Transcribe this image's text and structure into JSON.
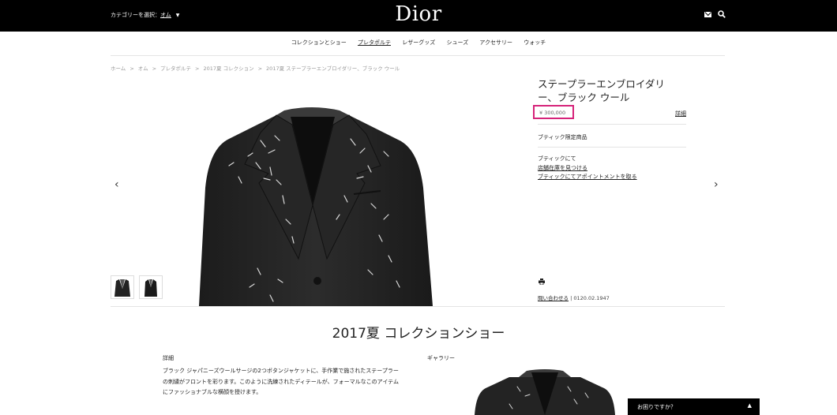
{
  "header": {
    "category_label": "カテゴリーを選択：",
    "category_value": "オム",
    "logo": "Dior",
    "icons": [
      "mail-icon",
      "search-icon"
    ]
  },
  "nav": {
    "items": [
      "コレクションとショー",
      "プレタポルテ",
      "レザーグッズ",
      "シューズ",
      "アクセサリー",
      "ウォッチ"
    ]
  },
  "breadcrumb": {
    "items": [
      "ホーム",
      "オム",
      "プレタポルテ",
      "2017夏 コレクション",
      "2017夏 ステープラーエンブロイダリー、ブラック ウール"
    ],
    "separator": ">"
  },
  "product": {
    "title_line1": "ステープラーエンブロイダリ",
    "title_line2": "ー、ブラック ウール",
    "price": "¥ 300,000",
    "detail_link": "詳細",
    "limited": "ブティック限定商品",
    "boutique_heading": "ブティックにて",
    "find_store": "店舗在庫を見つける",
    "appointment": "ブティックにてアポイントメントを取る",
    "contact_link": "問い合わせる",
    "phone": "| 0120.02.1947"
  },
  "section": {
    "title": "2017夏 コレクションショー",
    "details_label": "詳細",
    "description_line1": "ブラック ジャパニーズウールサージの2つボタンジャケットに、手作業で施されたステープラー",
    "description_line2": "の刺繍がフロントを彩ります。このように洗練されたディテールが、フォーマルなこのアイテム",
    "description_line3": "にファッショナブルな横顔を授けます。",
    "gallery_label": "ギャラリー"
  },
  "help": {
    "label": "お困りですか？",
    "caret": "▲"
  },
  "carousel": {
    "prev": "‹",
    "next": "›"
  },
  "colors": {
    "topbar": "#000000",
    "price_highlight": "#d6237a"
  }
}
